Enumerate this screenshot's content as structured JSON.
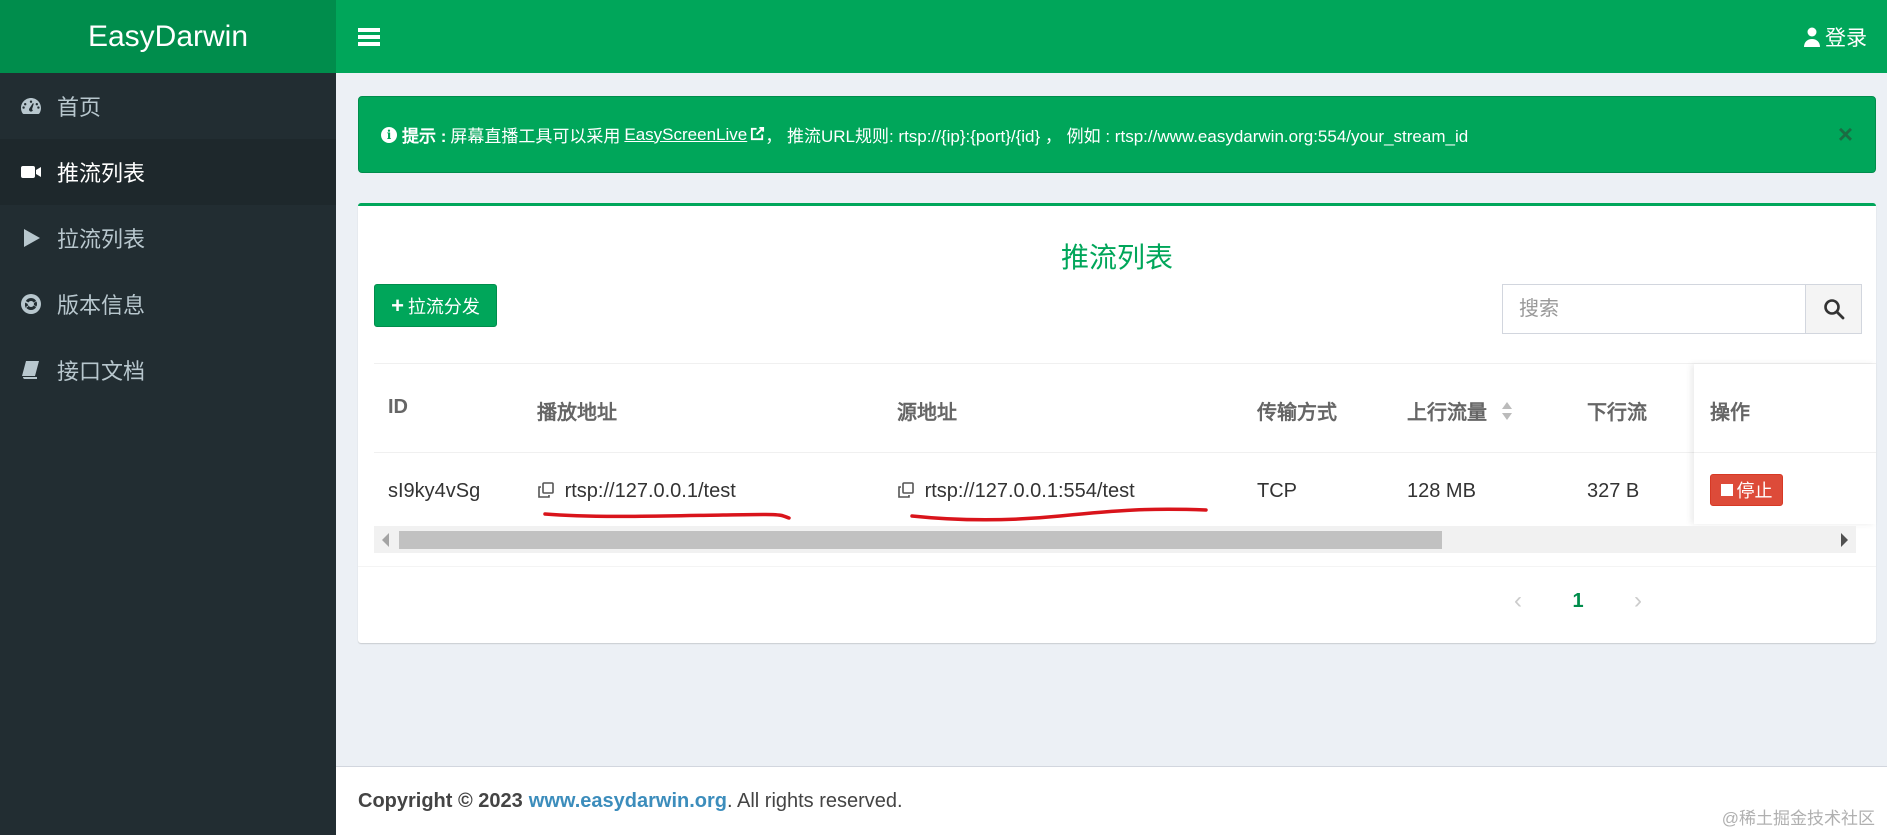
{
  "brand": {
    "name": "EasyDarwin"
  },
  "sidebar": {
    "items": [
      {
        "label": "首页",
        "icon": "dashboard-icon",
        "active": false
      },
      {
        "label": "推流列表",
        "icon": "video-camera-icon",
        "active": true
      },
      {
        "label": "拉流列表",
        "icon": "play-icon",
        "active": false
      },
      {
        "label": "版本信息",
        "icon": "life-ring-icon",
        "active": false
      },
      {
        "label": "接口文档",
        "icon": "book-icon",
        "active": false
      }
    ]
  },
  "header": {
    "login_label": "登录"
  },
  "alert": {
    "label": "提示 :",
    "text_before": "屏幕直播工具可以采用",
    "link_text": "EasyScreenLive",
    "text_after": "， 推流URL规则: rtsp://{ip}:{port}/{id} ， 例如 : rtsp://www.easydarwin.org:554/your_stream_id",
    "close": "×"
  },
  "main": {
    "title": "推流列表",
    "add_button": "拉流分发",
    "search_placeholder": "搜索"
  },
  "table": {
    "columns": [
      "ID",
      "播放地址",
      "源地址",
      "传输方式",
      "上行流量",
      "下行流",
      "操作"
    ],
    "rows": [
      {
        "id": "sI9ky4vSg",
        "play_url": "rtsp://127.0.0.1/test",
        "source_url": "rtsp://127.0.0.1:554/test",
        "transport": "TCP",
        "upstream": "128 MB",
        "downstream": "327 B",
        "action": "停止"
      }
    ]
  },
  "pagination": {
    "prev": "‹",
    "current": "1",
    "next": "›"
  },
  "footer": {
    "copyright": "Copyright © 2023",
    "link": "www.easydarwin.org",
    "rest": ". All rights reserved."
  },
  "watermark": "@稀土掘金技术社区",
  "colors": {
    "primary": "#00a65a",
    "primary_dark": "#008d4c",
    "sidebar": "#222d32",
    "danger": "#dd4b39",
    "annotation": "#d9141b"
  }
}
